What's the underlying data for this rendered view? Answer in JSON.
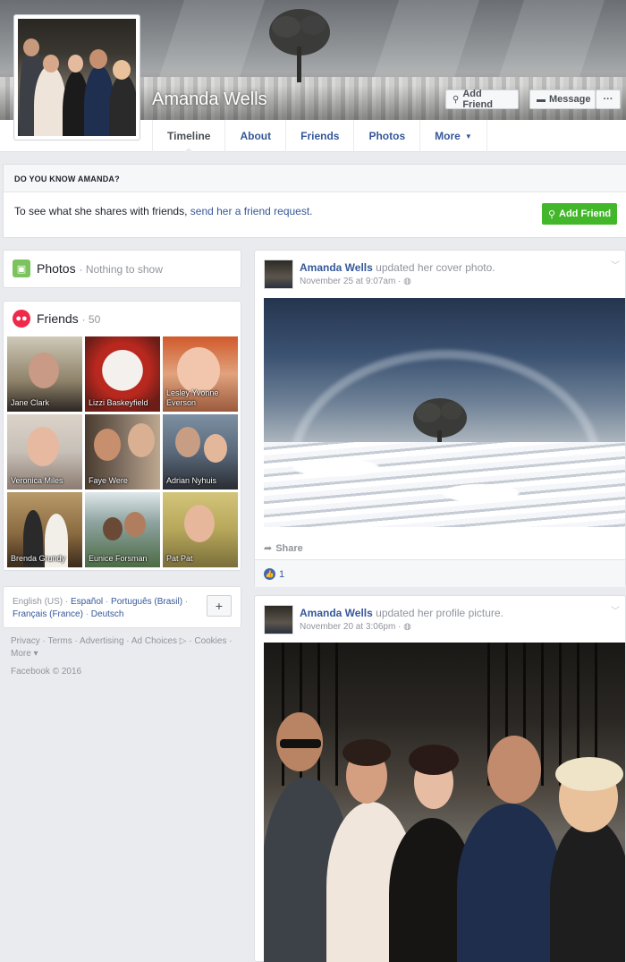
{
  "profile": {
    "name": "Amanda Wells",
    "buttons": {
      "add_friend": "Add Friend",
      "message": "Message",
      "more": "···"
    }
  },
  "tabs": [
    {
      "label": "Timeline",
      "active": true
    },
    {
      "label": "About"
    },
    {
      "label": "Friends"
    },
    {
      "label": "Photos"
    },
    {
      "label": "More"
    }
  ],
  "know": {
    "heading": "DO YOU KNOW AMANDA?",
    "text": "To see what she shares with friends, ",
    "link": "send her a friend request.",
    "button": "Add Friend"
  },
  "photos_section": {
    "title": "Photos",
    "subtitle": "· Nothing to show"
  },
  "friends_section": {
    "title": "Friends",
    "count": "· 50",
    "friends": [
      {
        "name": "Jane Clark"
      },
      {
        "name": "Lizzi Baskeyfield"
      },
      {
        "name": "Lesley Yvonne Everson"
      },
      {
        "name": "Veronica Miles"
      },
      {
        "name": "Faye Were"
      },
      {
        "name": "Adrian Nyhuis"
      },
      {
        "name": "Brenda Grundy"
      },
      {
        "name": "Eunice Forsman"
      },
      {
        "name": "Pat Pat"
      }
    ]
  },
  "languages": {
    "current": "English (US) · ",
    "others": [
      "Español",
      "Português (Brasil)",
      "Français (France)",
      "Deutsch"
    ],
    "plus": "+"
  },
  "footer": {
    "links": "Privacy · Terms · Advertising · Ad Choices ▷ · Cookies · More ▾",
    "copyright": "Facebook © 2016"
  },
  "posts": [
    {
      "author": "Amanda Wells",
      "action": "updated her cover photo.",
      "time": "November 25 at 9:07am · ",
      "share_label": "Share",
      "likes": "1"
    },
    {
      "author": "Amanda Wells",
      "action": "updated her profile picture.",
      "time": "November 20 at 3:06pm · "
    }
  ],
  "colors": {
    "brand_blue": "#365899",
    "add_friend_green": "#42b72a",
    "like_blue": "#4267b2"
  }
}
